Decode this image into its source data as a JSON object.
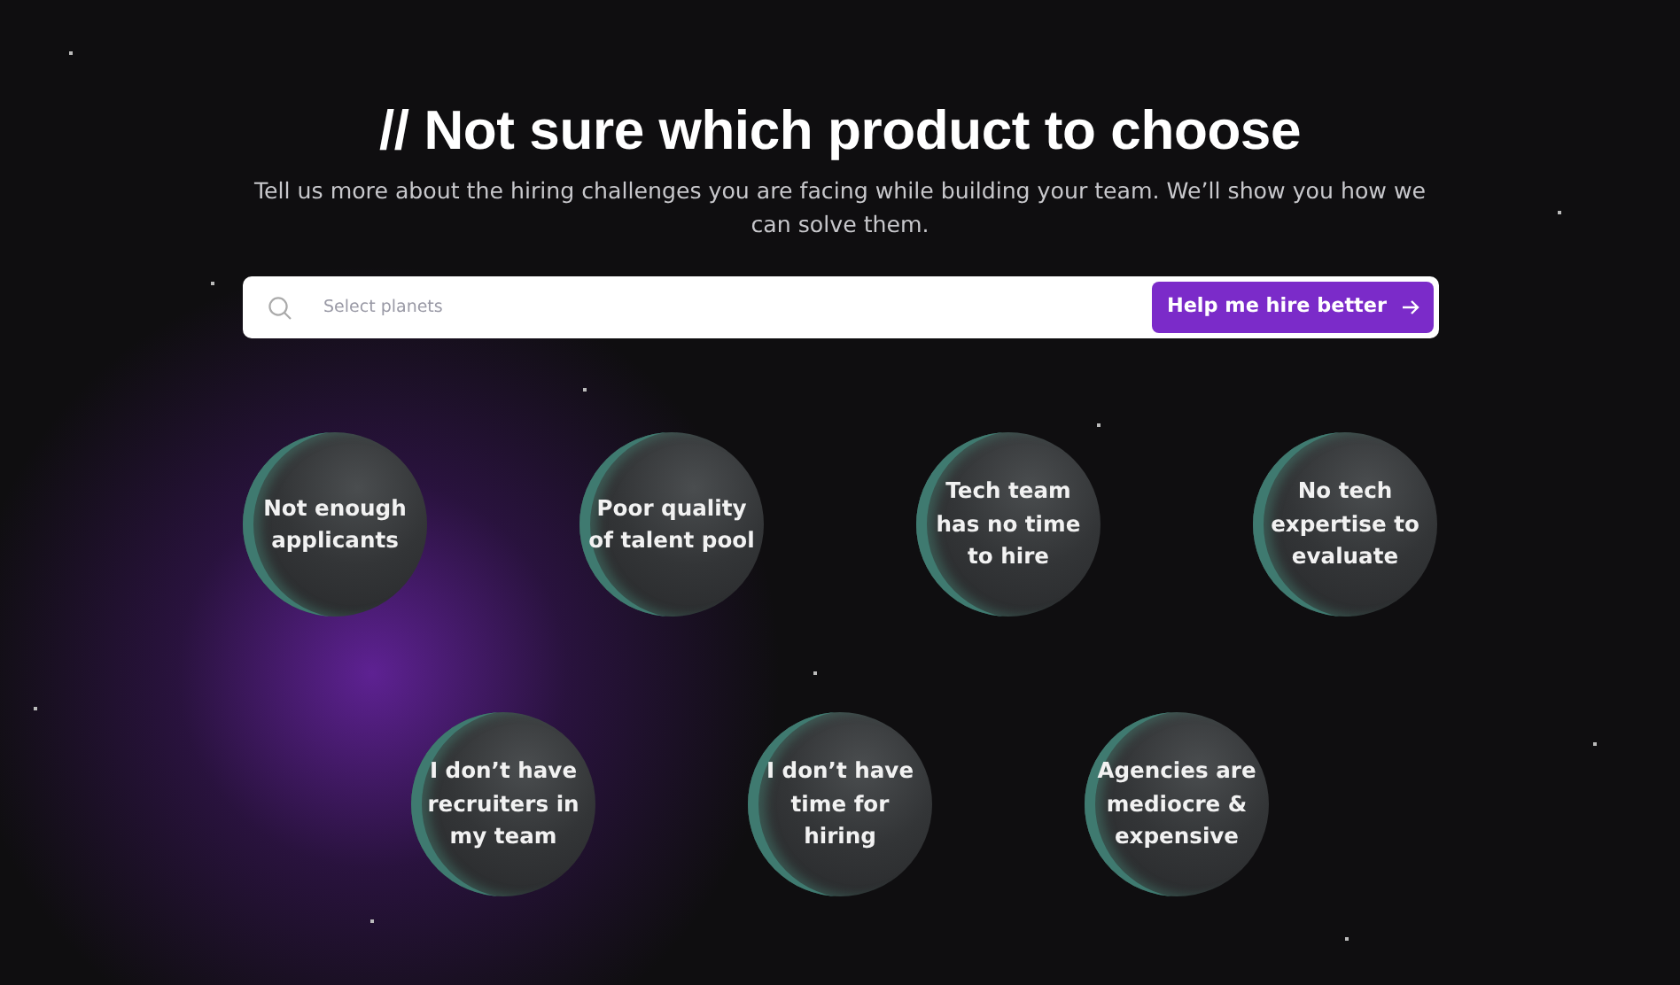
{
  "heading": "// Not sure which product to choose",
  "subtitle": "Tell us more about the hiring challenges you are facing while building your team. We’ll show you how we can solve them.",
  "search": {
    "placeholder": "Select planets",
    "button": "Help me hire better"
  },
  "planet_rows": [
    {
      "planets": [
        {
          "label": "Not enough applicants"
        },
        {
          "label": "Poor quality of talent pool"
        },
        {
          "label": "Tech team has no time to hire"
        },
        {
          "label": "No tech expertise to evaluate"
        }
      ]
    },
    {
      "planets": [
        {
          "label": "I don’t have recruiters in my team"
        },
        {
          "label": "I don’t have time for hiring"
        },
        {
          "label": "Agencies are mediocre & expensive"
        }
      ]
    }
  ]
}
